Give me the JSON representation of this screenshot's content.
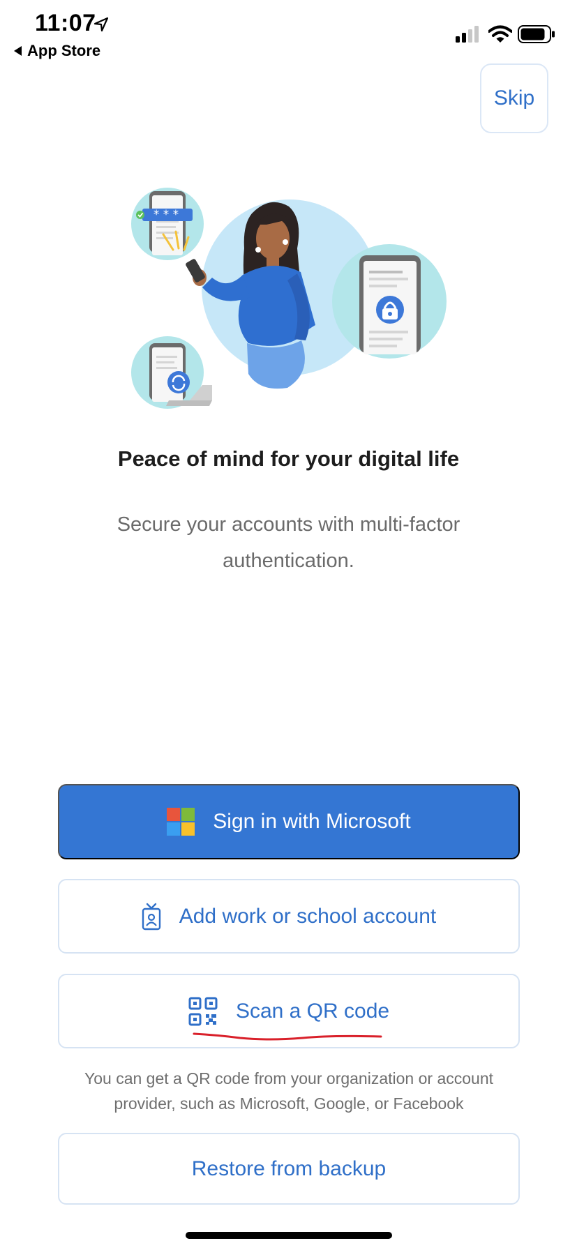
{
  "status_bar": {
    "time": "11:07",
    "back_label": "App Store",
    "icons": [
      "location-arrow-icon",
      "cellular-signal-icon",
      "wifi-icon",
      "battery-icon"
    ]
  },
  "header": {
    "skip_label": "Skip"
  },
  "hero": {
    "heading": "Peace of mind for your digital life",
    "subtitle": "Secure your accounts with multi-factor authentication."
  },
  "actions": {
    "sign_in_microsoft": "Sign in with Microsoft",
    "add_work_school": "Add work or school account",
    "scan_qr": "Scan a QR code",
    "qr_hint": "You can get a QR code from your organization or account provider, such as Microsoft, Google, or Facebook",
    "restore_backup": "Restore from backup"
  },
  "colors": {
    "accent": "#3476d3",
    "link_text": "#2f6fc8",
    "outline_border": "#d6e3f3",
    "annotation_red": "#d9202a"
  }
}
